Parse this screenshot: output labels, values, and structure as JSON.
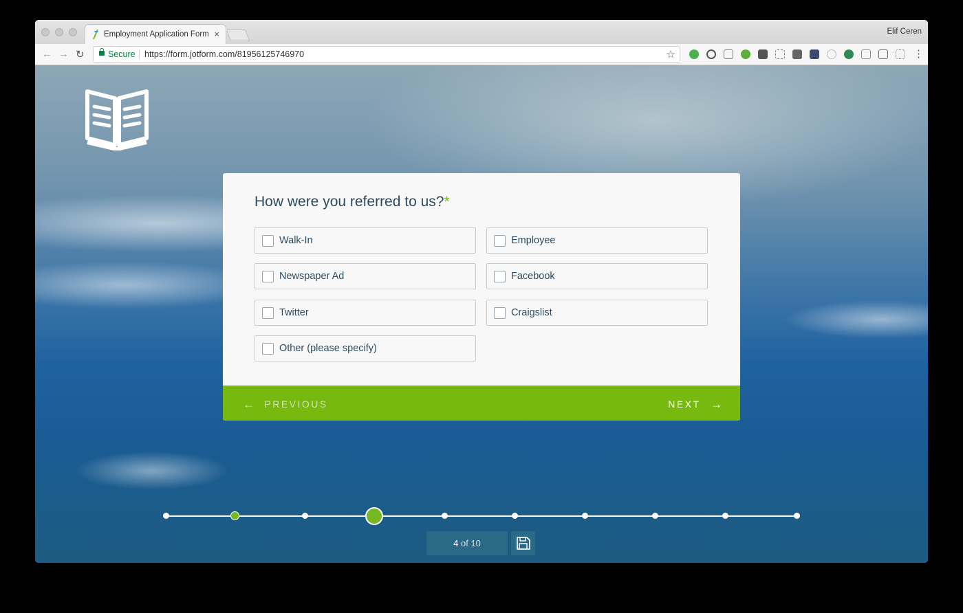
{
  "browser": {
    "tab_title": "Employment Application Form",
    "tab_close": "×",
    "profile_name": "Elif Ceren",
    "back_glyph": "←",
    "forward_glyph": "→",
    "reload_glyph": "↻",
    "secure_label": "Secure",
    "url": "https://form.jotform.com/81956125746970",
    "bookmark_glyph": "☆",
    "menu_glyph": "⋮"
  },
  "form": {
    "question": "How were you referred to us?",
    "required_mark": "*",
    "options": [
      {
        "label": "Walk-In",
        "checked": false
      },
      {
        "label": "Employee",
        "checked": false
      },
      {
        "label": "Newspaper Ad",
        "checked": false
      },
      {
        "label": "Facebook",
        "checked": false
      },
      {
        "label": "Twitter",
        "checked": false
      },
      {
        "label": "Craigslist",
        "checked": false
      },
      {
        "label": "Other (please specify)",
        "checked": false
      }
    ],
    "previous_label": "PREVIOUS",
    "next_label": "NEXT",
    "prev_arrow": "←",
    "next_arrow": "→"
  },
  "progress": {
    "current": "4",
    "of_text": "of 10",
    "total_steps": 10
  },
  "colors": {
    "accent": "#77b90f",
    "text": "#2c4b5e",
    "pager_bg": "#2b6a87"
  }
}
